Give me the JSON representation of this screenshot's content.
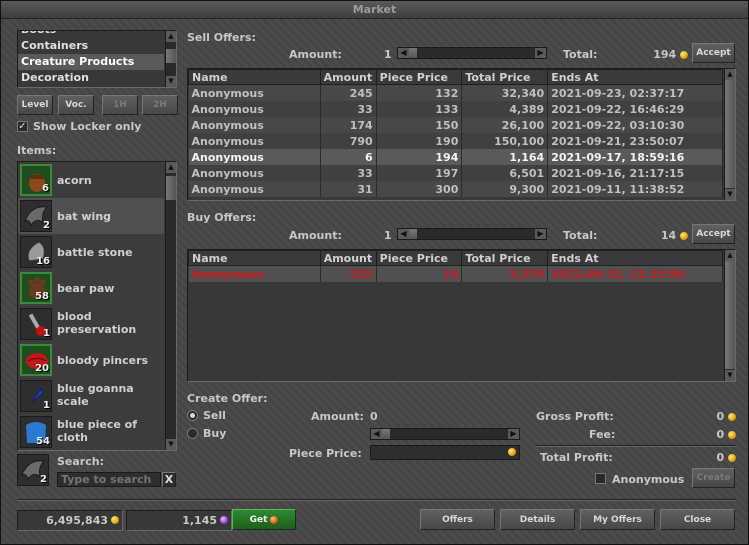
{
  "window": {
    "title": "Market"
  },
  "categories": {
    "items": [
      "Boots",
      "Containers",
      "Creature Products",
      "Decoration"
    ],
    "selected_index": 2
  },
  "filters": {
    "level_label": "Level",
    "voc_label": "Voc.",
    "one_hand_label": "1H",
    "two_hand_label": "2H",
    "show_locker_label": "Show Locker only",
    "show_locker_checked": true
  },
  "items_panel": {
    "label": "Items:",
    "items": [
      {
        "name": "acorn",
        "count": "6",
        "icon": "acorn-icon",
        "highlight": true
      },
      {
        "name": "bat wing",
        "count": "2",
        "icon": "bat-wing-icon",
        "highlight": false,
        "selected": true
      },
      {
        "name": "battle stone",
        "count": "16",
        "icon": "battle-stone-icon",
        "highlight": false
      },
      {
        "name": "bear paw",
        "count": "58",
        "icon": "bear-paw-icon",
        "highlight": true
      },
      {
        "name": "blood preservation",
        "count": "1",
        "icon": "blood-preservation-icon",
        "highlight": false
      },
      {
        "name": "bloody pincers",
        "count": "20",
        "icon": "bloody-pincers-icon",
        "highlight": true
      },
      {
        "name": "blue goanna scale",
        "count": "1",
        "icon": "blue-goanna-scale-icon",
        "highlight": false
      },
      {
        "name": "blue piece of cloth",
        "count": "54",
        "icon": "blue-cloth-icon",
        "highlight": false
      }
    ]
  },
  "search": {
    "label": "Search:",
    "placeholder": "Type to search",
    "clear_label": "X",
    "selected_count": "2"
  },
  "sell_offers": {
    "label": "Sell Offers:",
    "amount_label": "Amount:",
    "amount_value": "1",
    "total_label": "Total:",
    "total_value": "194",
    "accept_label": "Accept",
    "columns": [
      "Name",
      "Amount",
      "Piece Price",
      "Total Price",
      "Ends At"
    ],
    "rows": [
      {
        "name": "Anonymous",
        "amount": "245",
        "piece": "132",
        "total": "32,340",
        "ends": "2021-09-23, 02:37:17"
      },
      {
        "name": "Anonymous",
        "amount": "33",
        "piece": "133",
        "total": "4,389",
        "ends": "2021-09-22, 16:46:29"
      },
      {
        "name": "Anonymous",
        "amount": "174",
        "piece": "150",
        "total": "26,100",
        "ends": "2021-09-22, 03:10:30"
      },
      {
        "name": "Anonymous",
        "amount": "790",
        "piece": "190",
        "total": "150,100",
        "ends": "2021-09-21, 23:50:07"
      },
      {
        "name": "Anonymous",
        "amount": "6",
        "piece": "194",
        "total": "1,164",
        "ends": "2021-09-17, 18:59:16"
      },
      {
        "name": "Anonymous",
        "amount": "33",
        "piece": "197",
        "total": "6,501",
        "ends": "2021-09-16, 21:17:15"
      },
      {
        "name": "Anonymous",
        "amount": "31",
        "piece": "300",
        "total": "9,300",
        "ends": "2021-09-11, 11:38:52"
      }
    ],
    "selected_index": 4
  },
  "buy_offers": {
    "label": "Buy Offers:",
    "amount_label": "Amount:",
    "amount_value": "1",
    "total_label": "Total:",
    "total_value": "14",
    "accept_label": "Accept",
    "columns": [
      "Name",
      "Amount",
      "Piece Price",
      "Total Price",
      "Ends At"
    ],
    "rows": [
      {
        "name": "Anonymous",
        "amount": "255",
        "piece": "14",
        "total": "3,570",
        "ends": "2021-09-15, 11:33:50"
      }
    ]
  },
  "create_offer": {
    "label": "Create Offer:",
    "sell_label": "Sell",
    "buy_label": "Buy",
    "selected": "sell",
    "amount_label": "Amount:",
    "amount_value": "0",
    "piece_price_label": "Piece Price:",
    "gross_profit_label": "Gross Profit:",
    "gross_profit_value": "0",
    "fee_label": "Fee:",
    "fee_value": "0",
    "total_profit_label": "Total Profit:",
    "total_profit_value": "0",
    "anonymous_label": "Anonymous",
    "anonymous_checked": false,
    "create_label": "Create"
  },
  "footer": {
    "gold_balance": "6,495,843",
    "tibia_coins": "1,145",
    "get_label": "Get",
    "offers_label": "Offers",
    "details_label": "Details",
    "my_offers_label": "My Offers",
    "close_label": "Close"
  },
  "colors": {
    "buy_offer_text": "#d01818",
    "coin_gold": "#e6a400",
    "highlight_slot": "#3a8a3a"
  }
}
